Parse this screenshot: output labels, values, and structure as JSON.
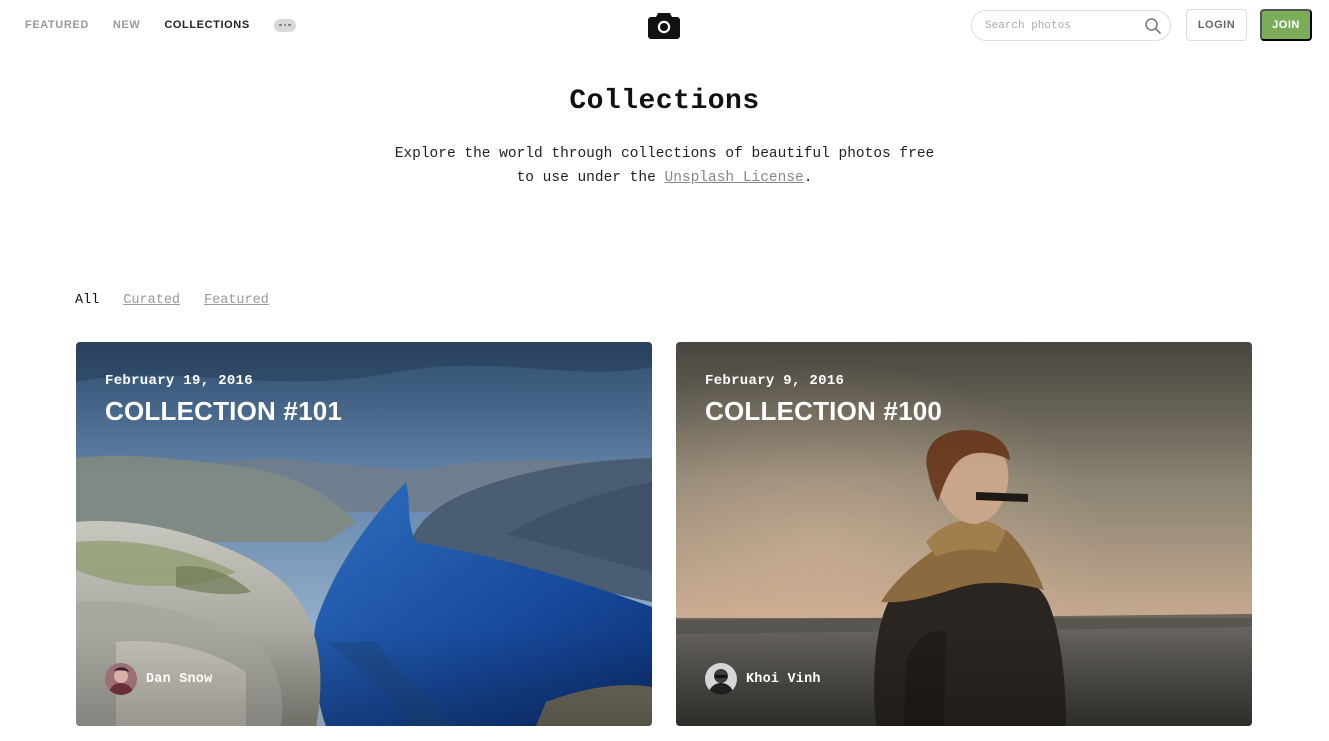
{
  "nav": {
    "links": [
      "FEATURED",
      "NEW",
      "COLLECTIONS"
    ],
    "more_icon": "ellipsis-icon"
  },
  "logo_icon": "camera-icon",
  "search": {
    "placeholder": "Search photos",
    "icon": "search-icon"
  },
  "auth": {
    "login_label": "LOGIN",
    "join_label": "JOIN"
  },
  "hero": {
    "title": "Collections",
    "subtitle_line1": "Explore the world through collections of beautiful photos free",
    "subtitle_line2_pre": "to use under the ",
    "license_link": "Unsplash License",
    "subtitle_line2_post": "."
  },
  "filters": [
    "All",
    "Curated",
    "Featured"
  ],
  "collections": [
    {
      "date": "February 19, 2016",
      "title": "COLLECTION #101",
      "author": "Dan Snow"
    },
    {
      "date": "February 9, 2016",
      "title": "COLLECTION #100",
      "author": "Khoi Vinh"
    }
  ],
  "colors": {
    "join": "#7aac5a",
    "active_nav": "#222222",
    "inactive_nav": "#999999"
  }
}
